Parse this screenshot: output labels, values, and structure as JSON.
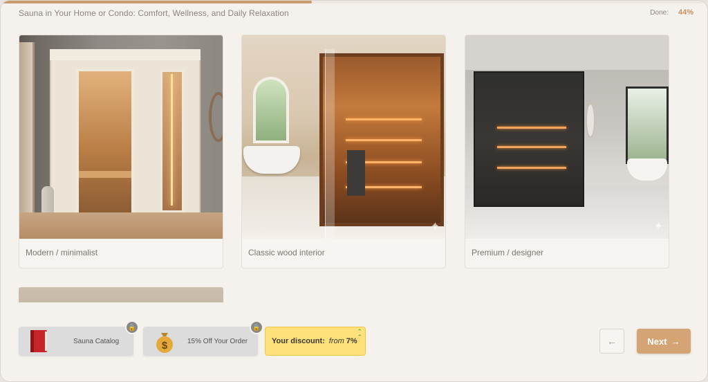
{
  "header": {
    "title": "Sauna in Your Home or Condo: Comfort, Wellness, and Daily Relaxation",
    "done_label": "Done:",
    "done_value": "44%",
    "progress": 0.44
  },
  "options": [
    {
      "label": "Modern / minimalist"
    },
    {
      "label": "Classic wood interior"
    },
    {
      "label": "Premium / designer"
    }
  ],
  "rewards": {
    "catalog_label": "Sauna Catalog",
    "discount_order_label": "15% Off Your Order",
    "your_discount_label": "Your discount:",
    "your_discount_from": "from",
    "your_discount_value": "7%"
  },
  "nav": {
    "back_icon": "←",
    "next_label": "Next",
    "next_icon": "→"
  },
  "colors": {
    "accent": "#d4a474",
    "discount_bg": "#ffe07a",
    "progress": "#c99a6e"
  }
}
